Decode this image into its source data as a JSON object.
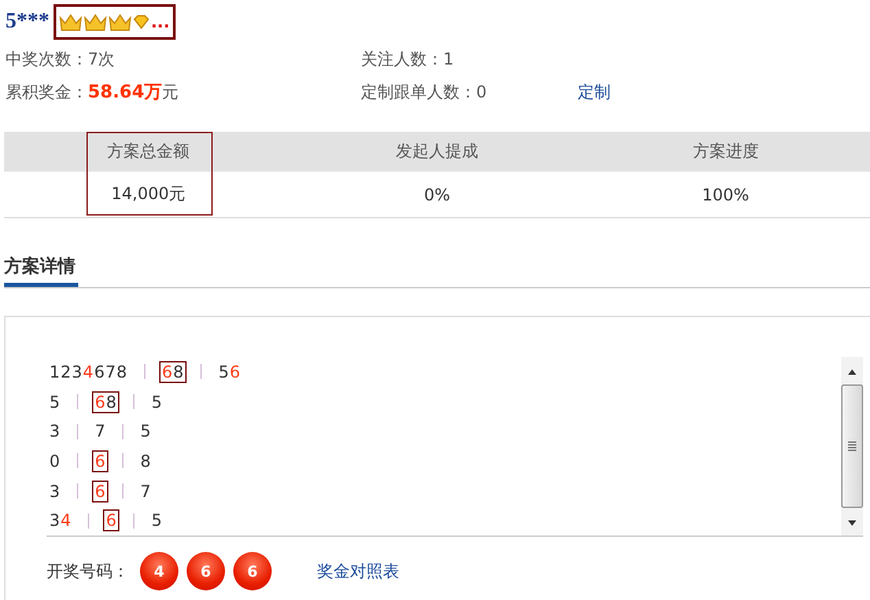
{
  "user": {
    "name": "5***",
    "badges": [
      {
        "kind": "crown"
      },
      {
        "kind": "crown"
      },
      {
        "kind": "crown"
      },
      {
        "kind": "diamond"
      }
    ],
    "more": "..."
  },
  "stats": [
    {
      "label": "中奖次数：",
      "value": "7次",
      "kind": "plain"
    },
    {
      "label": "关注人数：",
      "value": "1",
      "kind": "plain"
    },
    {
      "label": "累积奖金：",
      "value": "58.64万",
      "unit": "元",
      "kind": "money"
    },
    {
      "label": "定制跟单人数：",
      "value": "0",
      "kind": "plain",
      "link": "定制"
    }
  ],
  "summary": {
    "columns": [
      {
        "heading": "方案总金额",
        "value": "14,000元",
        "boxed": true
      },
      {
        "heading": "发起人提成",
        "value": "0%",
        "boxed": false
      },
      {
        "heading": "方案进度",
        "value": "100%",
        "boxed": false
      }
    ]
  },
  "section": {
    "title": "方案详情"
  },
  "picks": [
    [
      {
        "boxed": false,
        "digits": [
          {
            "d": "1",
            "hit": false
          },
          {
            "d": "2",
            "hit": false
          },
          {
            "d": "3",
            "hit": false
          },
          {
            "d": "4",
            "hit": true
          },
          {
            "d": "6",
            "hit": false
          },
          {
            "d": "7",
            "hit": false
          },
          {
            "d": "8",
            "hit": false
          }
        ]
      },
      {
        "boxed": true,
        "digits": [
          {
            "d": "6",
            "hit": true
          },
          {
            "d": "8",
            "hit": false
          }
        ]
      },
      {
        "boxed": false,
        "digits": [
          {
            "d": "5",
            "hit": false
          },
          {
            "d": "6",
            "hit": true
          }
        ]
      }
    ],
    [
      {
        "boxed": false,
        "digits": [
          {
            "d": "5",
            "hit": false
          }
        ]
      },
      {
        "boxed": true,
        "digits": [
          {
            "d": "6",
            "hit": true
          },
          {
            "d": "8",
            "hit": false
          }
        ]
      },
      {
        "boxed": false,
        "digits": [
          {
            "d": "5",
            "hit": false
          }
        ]
      }
    ],
    [
      {
        "boxed": false,
        "digits": [
          {
            "d": "3",
            "hit": false
          }
        ]
      },
      {
        "boxed": false,
        "digits": [
          {
            "d": "7",
            "hit": false
          }
        ]
      },
      {
        "boxed": false,
        "digits": [
          {
            "d": "5",
            "hit": false
          }
        ]
      }
    ],
    [
      {
        "boxed": false,
        "digits": [
          {
            "d": "0",
            "hit": false
          }
        ]
      },
      {
        "boxed": true,
        "digits": [
          {
            "d": "6",
            "hit": true
          }
        ]
      },
      {
        "boxed": false,
        "digits": [
          {
            "d": "8",
            "hit": false
          }
        ]
      }
    ],
    [
      {
        "boxed": false,
        "digits": [
          {
            "d": "3",
            "hit": false
          }
        ]
      },
      {
        "boxed": true,
        "digits": [
          {
            "d": "6",
            "hit": true
          }
        ]
      },
      {
        "boxed": false,
        "digits": [
          {
            "d": "7",
            "hit": false
          }
        ]
      }
    ],
    [
      {
        "boxed": false,
        "digits": [
          {
            "d": "3",
            "hit": false
          },
          {
            "d": "4",
            "hit": true
          }
        ]
      },
      {
        "boxed": true,
        "digits": [
          {
            "d": "6",
            "hit": true
          }
        ]
      },
      {
        "boxed": false,
        "digits": [
          {
            "d": "5",
            "hit": false
          }
        ]
      }
    ]
  ],
  "draw": {
    "label": "开奖号码：",
    "balls": [
      "4",
      "6",
      "6"
    ],
    "link": "奖金对照表"
  }
}
